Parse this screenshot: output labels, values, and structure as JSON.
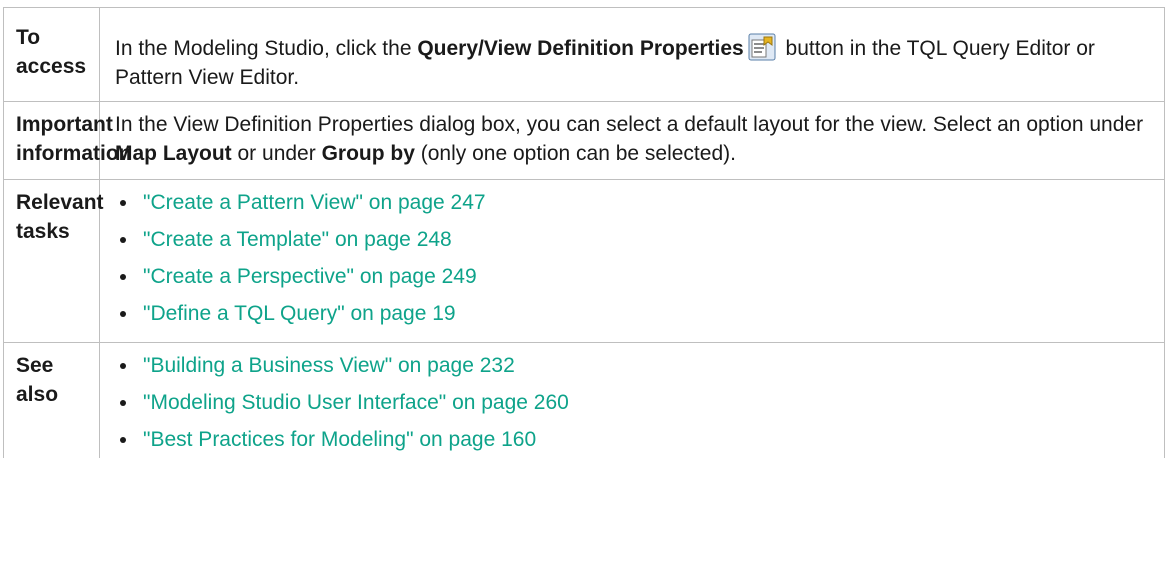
{
  "rows": {
    "access": {
      "label": "To access",
      "text_before": "In the Modeling Studio, click the ",
      "bold": "Query/View Definition Properties",
      "text_after": " button in the TQL Query Editor or Pattern View Editor."
    },
    "info": {
      "label": "Important information",
      "text_1": "In the View Definition Properties dialog box, you can select a default layout for the view. Select an option under ",
      "bold_1": "Map Layout",
      "text_2": " or under ",
      "bold_2": "Group by",
      "text_3": " (only one option can be selected)."
    },
    "tasks": {
      "label": "Relevant tasks",
      "links": [
        "\"Create a Pattern View\" on page 247",
        "\"Create a Template\" on page 248",
        "\"Create a Perspective\" on page 249",
        "\"Define a TQL Query\" on page 19"
      ]
    },
    "see_also": {
      "label": "See also",
      "links": [
        "\"Building a Business View\" on page 232",
        "\"Modeling Studio User Interface\" on page 260",
        "\"Best Practices for Modeling\" on page 160"
      ]
    }
  },
  "icons": {
    "properties_button": "properties-icon"
  },
  "colors": {
    "link": "#0ea38a",
    "border": "#bfbfbf"
  }
}
